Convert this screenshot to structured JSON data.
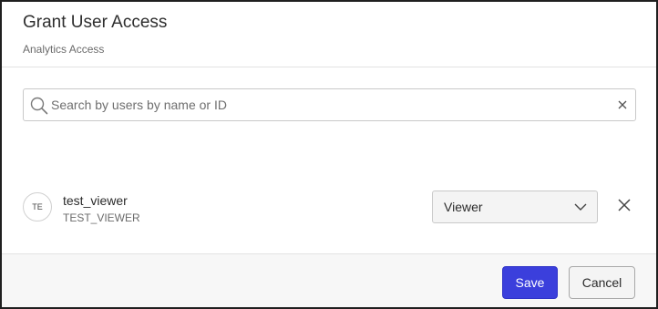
{
  "dialog": {
    "title": "Grant User Access",
    "subtitle": "Analytics Access"
  },
  "search": {
    "placeholder": "Search by users by name or ID",
    "value": "",
    "icon": "search-icon",
    "clear_icon": "close-icon"
  },
  "users": [
    {
      "initials": "TE",
      "name": "test_viewer",
      "id": "TEST_VIEWER",
      "role": "Viewer",
      "remove_icon": "close-icon"
    }
  ],
  "footer": {
    "save_label": "Save",
    "cancel_label": "Cancel"
  },
  "colors": {
    "primary": "#3b3fdc",
    "border": "#c9c9c9",
    "footer_bg": "#f7f7f7"
  }
}
